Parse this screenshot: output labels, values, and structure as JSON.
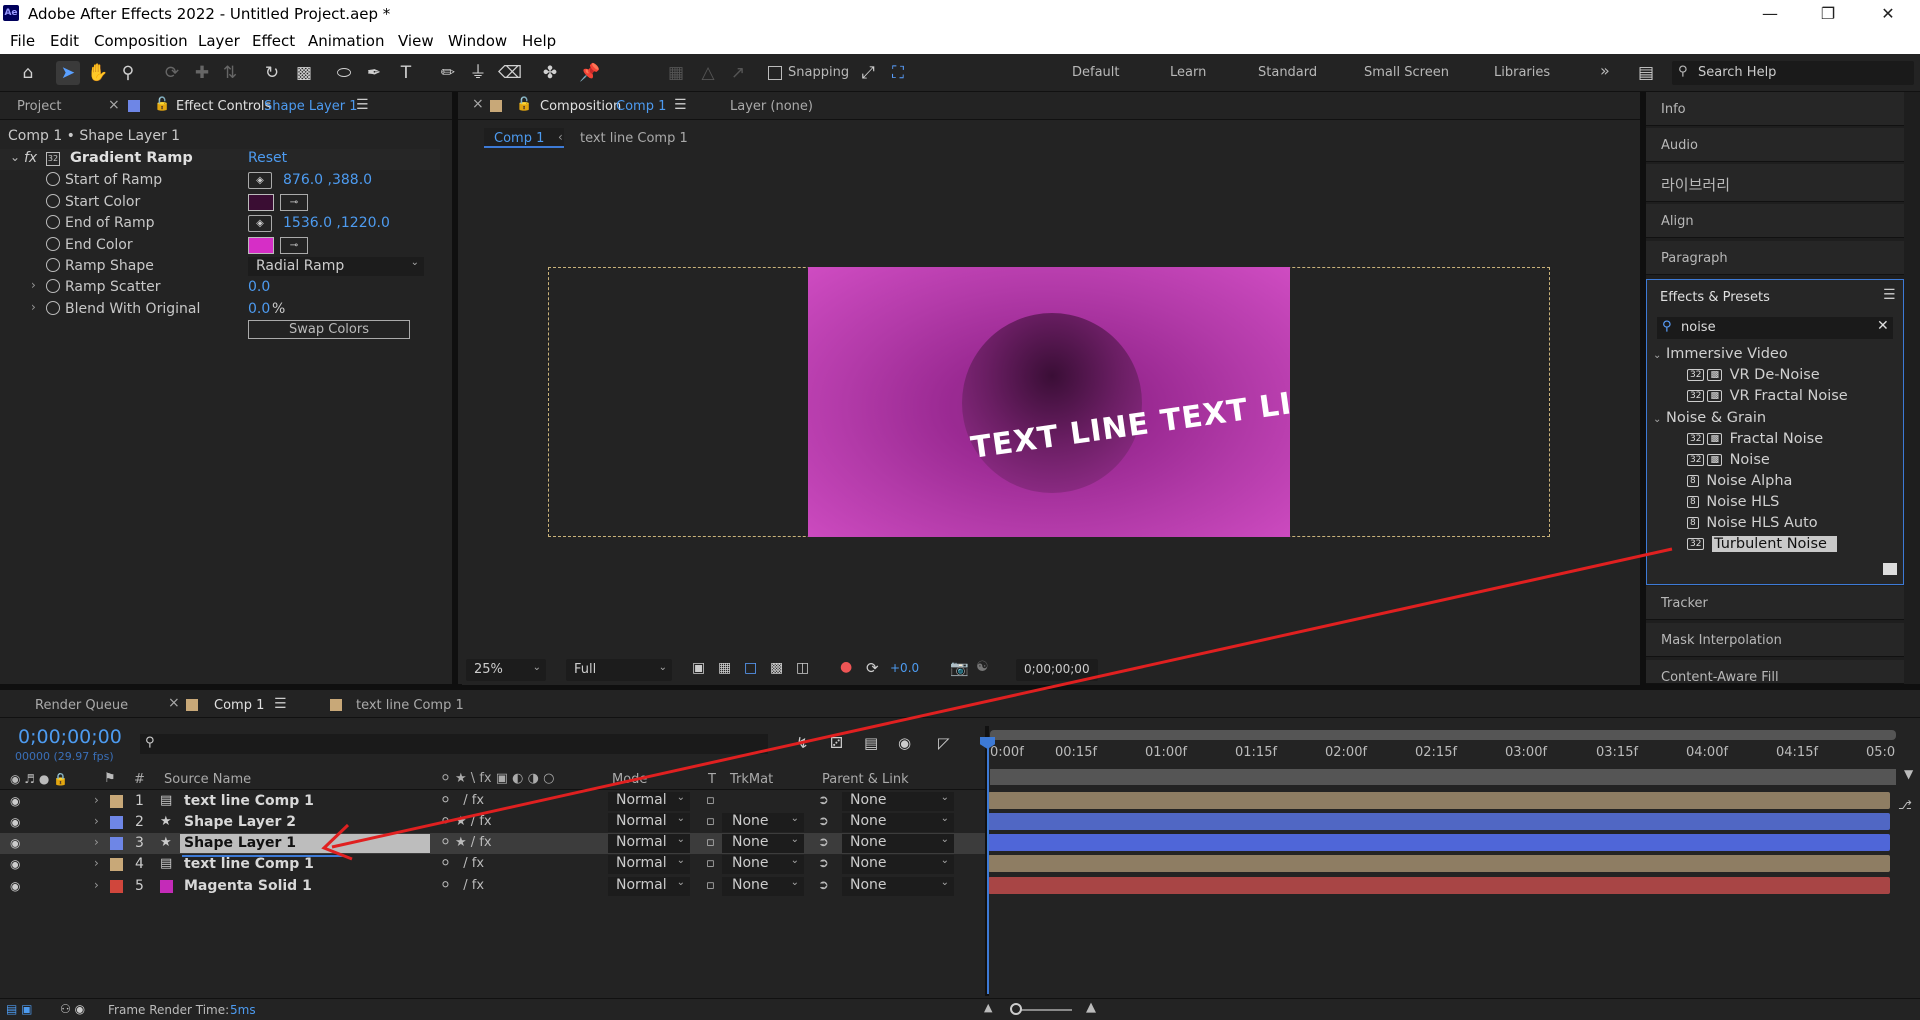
{
  "window": {
    "title": "Adobe After Effects 2022 - Untitled Project.aep *",
    "app_icon": "Ae",
    "controls": [
      "minimize-icon",
      "restore-icon",
      "close-icon"
    ]
  },
  "menu": [
    "File",
    "Edit",
    "Composition",
    "Layer",
    "Effect",
    "Animation",
    "View",
    "Window",
    "Help"
  ],
  "toolbar": {
    "snapping_label": "Snapping",
    "workspaces": [
      "Default",
      "Learn",
      "Standard",
      "Small Screen",
      "Libraries"
    ],
    "more": "»",
    "search_placeholder": "Search Help"
  },
  "left_panel": {
    "tab_project": "Project",
    "tab_effect_controls": "Effect Controls",
    "tab_effect_controls_layer": "Shape Layer 1",
    "breadcrumb": "Comp 1 • Shape Layer 1",
    "effect_name": "Gradient Ramp",
    "reset_label": "Reset",
    "props": [
      {
        "name": "Start of Ramp",
        "value": "876.0 ,388.0"
      },
      {
        "name": "Start Color",
        "color": "#3a0d33"
      },
      {
        "name": "End of Ramp",
        "value": "1536.0 ,1220.0"
      },
      {
        "name": "End Color",
        "color": "#d62ec6"
      },
      {
        "name": "Ramp Shape",
        "value": "Radial Ramp"
      },
      {
        "name": "Ramp Scatter",
        "value": "0.0"
      },
      {
        "name": "Blend With Original",
        "value": "0.0",
        "unit": "%"
      }
    ],
    "swap_colors": "Swap Colors"
  },
  "comp_panel": {
    "tab_label": "Composition",
    "tab_comp": "Comp 1",
    "layer_label": "Layer (none)",
    "subtab_active": "Comp 1",
    "subtab_other": "text line Comp 1",
    "canvas_text": "TEXT LINE TEXT LINE TEXT LINE TEXT",
    "zoom": "25%",
    "resolution": "Full",
    "exposure": "+0.0",
    "timecode": "0;00;00;00"
  },
  "right_panels": {
    "info": "Info",
    "audio": "Audio",
    "libraries_kr": "라이브러리",
    "align": "Align",
    "paragraph": "Paragraph",
    "effects_presets": "Effects & Presets",
    "search_value": "noise",
    "tracker": "Tracker",
    "mask_interpolation": "Mask Interpolation",
    "content_aware_fill": "Content-Aware Fill",
    "groups": [
      {
        "name": "Immersive Video",
        "items": [
          {
            "bits": "32",
            "label": "VR De-Noise"
          },
          {
            "bits": "32",
            "label": "VR Fractal Noise"
          }
        ]
      },
      {
        "name": "Noise & Grain",
        "items": [
          {
            "bits": "32",
            "label": "Fractal Noise"
          },
          {
            "bits": "32",
            "label": "Noise"
          },
          {
            "bits": "8",
            "label": "Noise Alpha"
          },
          {
            "bits": "8",
            "label": "Noise HLS"
          },
          {
            "bits": "8",
            "label": "Noise HLS Auto"
          },
          {
            "bits": "32",
            "label": "Turbulent Noise"
          }
        ]
      }
    ]
  },
  "timeline": {
    "tab_render_queue": "Render Queue",
    "tab_comp1": "Comp 1",
    "tab_text_line": "text line Comp 1",
    "timecode": "0;00;00;00",
    "frames_fps": "00000 (29.97 fps)",
    "columns": {
      "source_name": "Source Name",
      "mode": "Mode",
      "t": "T",
      "trkmat": "TrkMat",
      "parent": "Parent & Link"
    },
    "ruler": [
      "0:00f",
      "00:15f",
      "01:00f",
      "01:15f",
      "02:00f",
      "02:15f",
      "03:00f",
      "03:15f",
      "04:00f",
      "04:15f",
      "05:0"
    ],
    "layers": [
      {
        "num": "1",
        "name": "text line Comp 1",
        "type": "comp",
        "label_color": "#c8a878",
        "mode": "Normal",
        "trkmat": "",
        "parent": "None",
        "bar_color": "#8e7d63"
      },
      {
        "num": "2",
        "name": "Shape Layer 2",
        "type": "shape",
        "label_color": "#6e86e6",
        "mode": "Normal",
        "trkmat": "None",
        "parent": "None",
        "bar_color": "#5067c4"
      },
      {
        "num": "3",
        "name": "Shape Layer 1",
        "type": "shape",
        "label_color": "#6e86e6",
        "mode": "Normal",
        "trkmat": "None",
        "parent": "None",
        "bar_color": "#4f66d8"
      },
      {
        "num": "4",
        "name": "text line Comp 1",
        "type": "comp",
        "label_color": "#c8a878",
        "mode": "Normal",
        "trkmat": "None",
        "parent": "None",
        "bar_color": "#8e7d63"
      },
      {
        "num": "5",
        "name": "Magenta Solid 1",
        "type": "solid",
        "label_color": "#d0463c",
        "mode": "Normal",
        "trkmat": "None",
        "parent": "None",
        "bar_color": "#a84545"
      }
    ],
    "render_time_label": "Frame Render Time:",
    "render_time_value": "5ms"
  },
  "colors": {
    "accent_blue": "#4d9bf0",
    "annotation_red": "#e02020",
    "selection_border": "#3d7ad6"
  }
}
